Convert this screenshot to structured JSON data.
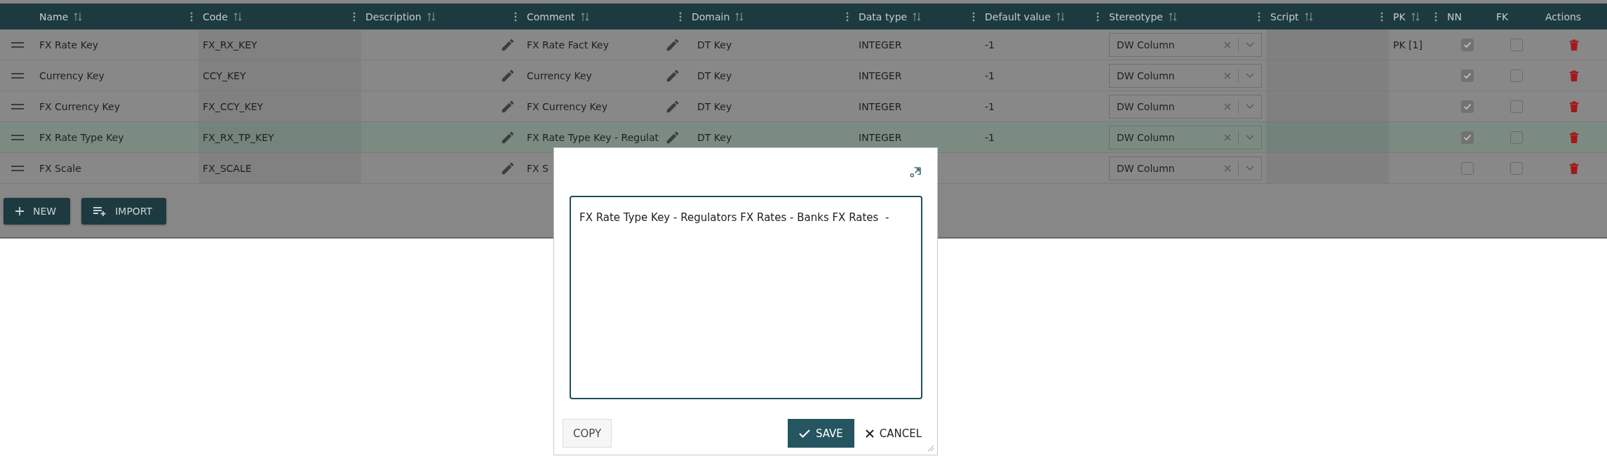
{
  "table": {
    "columns": [
      {
        "label": "Name",
        "sortable": true,
        "menu": true
      },
      {
        "label": "Code",
        "sortable": true,
        "menu": true
      },
      {
        "label": "Description",
        "sortable": true,
        "menu": true
      },
      {
        "label": "Comment",
        "sortable": true,
        "menu": true
      },
      {
        "label": "Domain",
        "sortable": true,
        "menu": true
      },
      {
        "label": "Data type",
        "sortable": true,
        "menu": true
      },
      {
        "label": "Default value",
        "sortable": true,
        "menu": true
      },
      {
        "label": "Stereotype",
        "sortable": true,
        "menu": true
      },
      {
        "label": "Script",
        "sortable": true,
        "menu": true
      },
      {
        "label": "PK",
        "sortable": true,
        "menu": true
      },
      {
        "label": "NN",
        "sortable": false,
        "menu": false
      },
      {
        "label": "FK",
        "sortable": false,
        "menu": false
      },
      {
        "label": "Actions",
        "sortable": false,
        "menu": false
      }
    ],
    "rows": [
      {
        "name": "FX Rate Key",
        "code": "FX_RX_KEY",
        "comment": "FX Rate Fact Key",
        "domain": "DT Key",
        "data_type": "INTEGER",
        "default_value": "-1",
        "stereotype": "DW Column",
        "pk": "PK [1]",
        "nn": true,
        "fk": false,
        "selected": false
      },
      {
        "name": "Currency Key",
        "code": "CCY_KEY",
        "comment": "Currency Key",
        "domain": "DT Key",
        "data_type": "INTEGER",
        "default_value": "-1",
        "stereotype": "DW Column",
        "nn": true,
        "fk": false,
        "selected": false
      },
      {
        "name": "FX Currency Key",
        "code": "FX_CCY_KEY",
        "comment": "FX Currency Key",
        "domain": "DT Key",
        "data_type": "INTEGER",
        "default_value": "-1",
        "stereotype": "DW Column",
        "nn": true,
        "fk": false,
        "selected": false
      },
      {
        "name": "FX Rate Type Key",
        "code": "FX_RX_TP_KEY",
        "comment": "FX Rate Type Key - Regulat",
        "domain": "DT Key",
        "data_type": "INTEGER",
        "default_value": "-1",
        "stereotype": "DW Column",
        "nn": true,
        "fk": false,
        "selected": true
      },
      {
        "name": "FX Scale",
        "code": "FX_SCALE",
        "comment": "FX S",
        "stereotype": "DW Column",
        "nn": false,
        "fk": false,
        "selected": false
      }
    ]
  },
  "buttons": [
    {
      "kind": "new",
      "label": "NEW"
    },
    {
      "kind": "import",
      "label": "IMPORT"
    }
  ],
  "dialog": {
    "value": "FX Rate Type Key - Regulators FX Rates - Banks FX Rates  -",
    "copy": "COPY",
    "save": "SAVE",
    "cancel": "CANCEL"
  }
}
